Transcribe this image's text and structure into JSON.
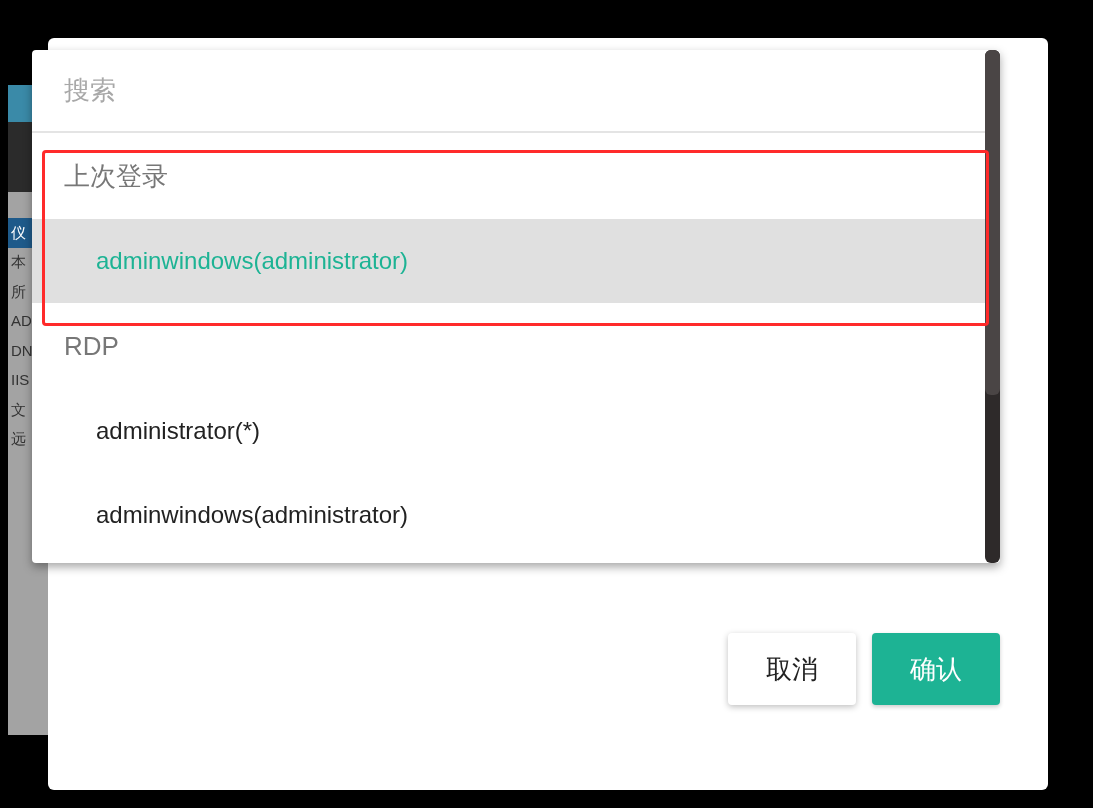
{
  "background_app": {
    "sidebar_items": [
      {
        "label": "仪",
        "selected": true
      },
      {
        "label": "本",
        "selected": false
      },
      {
        "label": "所",
        "selected": false
      },
      {
        "label": "AD",
        "selected": false
      },
      {
        "label": "DN",
        "selected": false
      },
      {
        "label": "IIS",
        "selected": false
      },
      {
        "label": "文",
        "selected": false
      },
      {
        "label": "远",
        "selected": false
      }
    ]
  },
  "dialog": {
    "dropdown": {
      "search": {
        "placeholder": "搜索"
      },
      "groups": [
        {
          "header": "上次登录",
          "items": [
            {
              "label": "adminwindows(administrator)",
              "selected": true
            }
          ]
        },
        {
          "header": "RDP",
          "items": [
            {
              "label": "administrator(*)",
              "selected": false
            },
            {
              "label": "adminwindows(administrator)",
              "selected": false
            }
          ]
        }
      ]
    },
    "buttons": [
      {
        "label": "取消",
        "kind": "secondary"
      },
      {
        "label": "确认",
        "kind": "primary"
      }
    ]
  }
}
